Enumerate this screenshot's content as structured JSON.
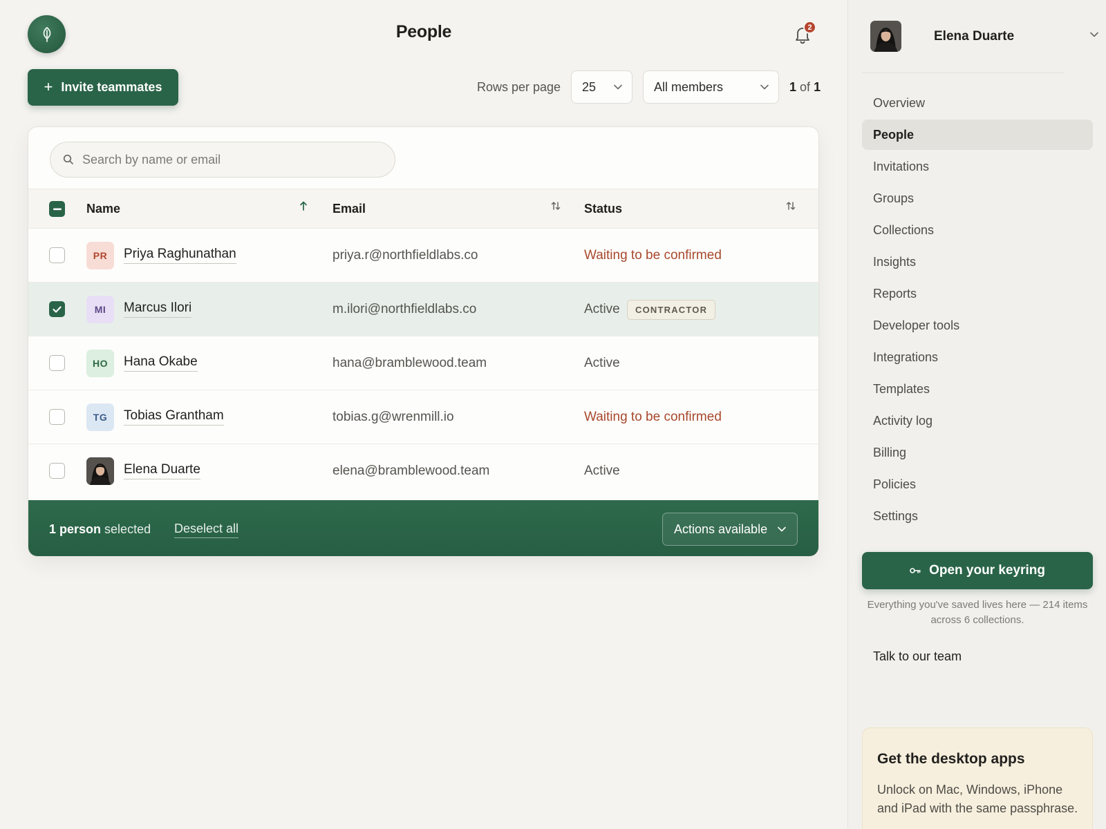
{
  "header": {
    "title": "People",
    "notification_count": "2"
  },
  "toolbar": {
    "invite_label": "Invite teammates",
    "rows_per_page_label": "Rows per page",
    "rows_per_page_value": "25",
    "filter_value": "All members",
    "pager_current": "1",
    "pager_of": "of",
    "pager_total": "1"
  },
  "search": {
    "placeholder": "Search by name or email"
  },
  "table": {
    "columns": [
      "Name",
      "Email",
      "Status"
    ],
    "rows": [
      {
        "initials": "PR",
        "name": "Priya Raghunathan",
        "email": "priya.r@northfieldlabs.co",
        "status": "Waiting to be confirmed",
        "tag": "",
        "selected": false
      },
      {
        "initials": "MI",
        "name": "Marcus Ilori",
        "email": "m.ilori@northfieldlabs.co",
        "status": "Active",
        "tag": "CONTRACTOR",
        "selected": true
      },
      {
        "initials": "HO",
        "name": "Hana Okabe",
        "email": "hana@bramblewood.team",
        "status": "Active",
        "tag": "",
        "selected": false
      },
      {
        "initials": "TG",
        "name": "Tobias Grantham",
        "email": "tobias.g@wrenmill.io",
        "status": "Waiting to be confirmed",
        "tag": "",
        "selected": false
      },
      {
        "initials": "",
        "name": "Elena Duarte",
        "email": "elena@bramblewood.team",
        "status": "Active",
        "tag": "",
        "selected": false
      }
    ]
  },
  "bulk": {
    "count_bold": "1 person",
    "count_rest": "selected",
    "deselect_label": "Deselect all",
    "actions_label": "Actions available"
  },
  "sidebar": {
    "user_name": "Elena Duarte",
    "items": [
      {
        "label": "Overview",
        "active": false
      },
      {
        "label": "People",
        "active": true
      },
      {
        "label": "Invitations",
        "active": false
      },
      {
        "label": "Groups",
        "active": false
      },
      {
        "label": "Collections",
        "active": false
      },
      {
        "label": "Insights",
        "active": false
      },
      {
        "label": "Reports",
        "active": false
      },
      {
        "label": "Developer tools",
        "active": false
      },
      {
        "label": "Integrations",
        "active": false
      },
      {
        "label": "Templates",
        "active": false
      },
      {
        "label": "Activity log",
        "active": false
      },
      {
        "label": "Billing",
        "active": false
      },
      {
        "label": "Policies",
        "active": false
      },
      {
        "label": "Settings",
        "active": false
      }
    ],
    "keyring_label": "Open your keyring",
    "keyring_note": "Everything you've saved lives here — 214 items across 6 collections.",
    "talk_label": "Talk to our team",
    "apps_title": "Get the desktop apps",
    "apps_text": "Unlock on Mac, Windows, iPhone and iPad with the same passphrase."
  },
  "colors": {
    "brand_green": "#2a6448",
    "pending_red": "#a8482d",
    "badge_red": "#b5452e",
    "avatar_pr_bg": "#f7ddd6",
    "avatar_mi_bg": "#e8def5",
    "avatar_ho_bg": "#dcefe0",
    "avatar_tg_bg": "#dce7f4"
  },
  "icons": {
    "logo": "leaf-icon",
    "notifications": "bell-icon",
    "search": "search-icon",
    "sort": "sort-arrows-icon",
    "keyring": "key-icon",
    "dropdown": "chevron-down-icon"
  }
}
